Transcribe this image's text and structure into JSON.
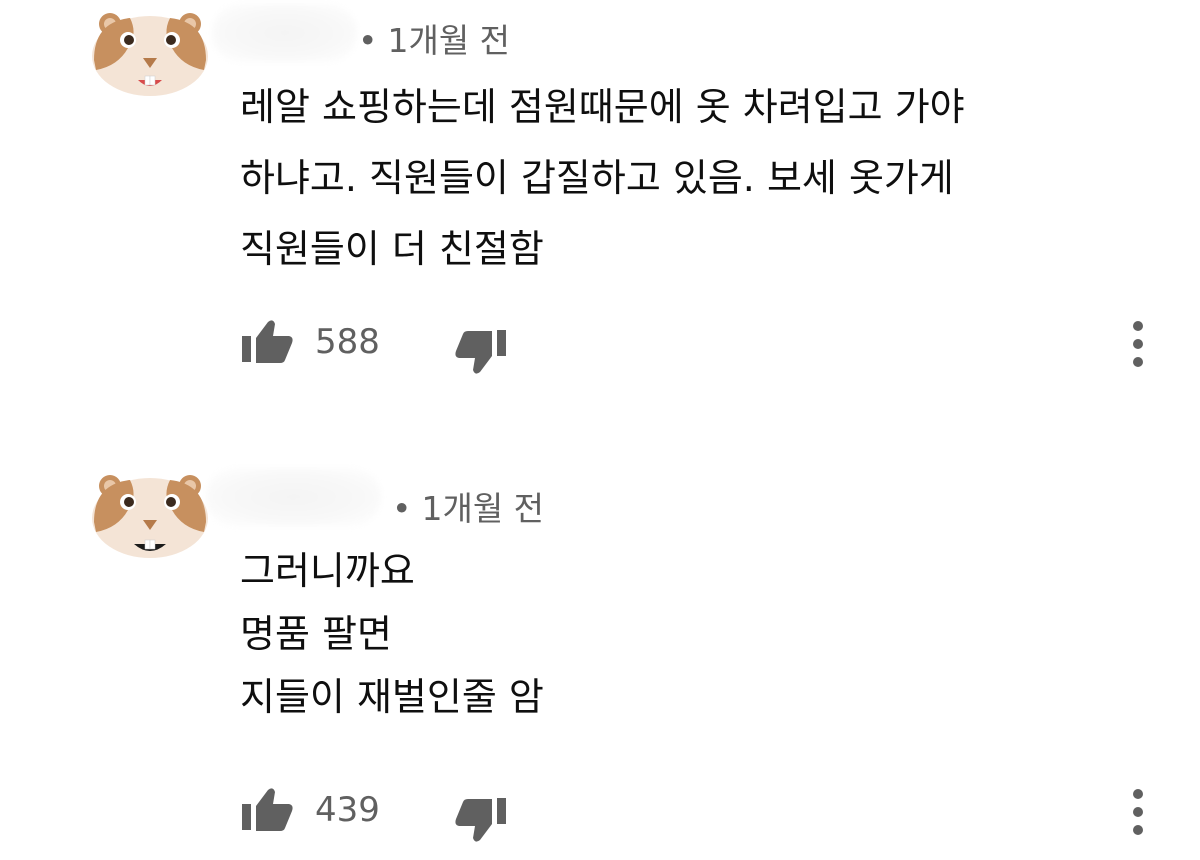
{
  "comments": [
    {
      "time": "1개월 전",
      "dot": "•",
      "lines": [
        "레알 쇼핑하는데 점원때문에 옷 차려입고 가야",
        "하냐고.  직원들이 갑질하고 있음. 보세 옷가게",
        "직원들이 더 친절함"
      ],
      "likes": "588",
      "author_hidden": true
    },
    {
      "time": "1개월 전",
      "dot": "•",
      "lines": [
        "그러니까요",
        "명품 팔면",
        "지들이 재벌인줄 암"
      ],
      "likes": "439",
      "author_hidden": true
    }
  ],
  "icons": {
    "avatar": "hamster-avatar-icon",
    "like": "thumbs-up-icon",
    "dislike": "thumbs-down-icon",
    "more": "more-vertical-icon"
  },
  "colors": {
    "text": "#0f0f0f",
    "secondary": "#606060",
    "icon": "#606060",
    "avatar_fur": "#c7905f",
    "avatar_face": "#f4e4d6"
  }
}
